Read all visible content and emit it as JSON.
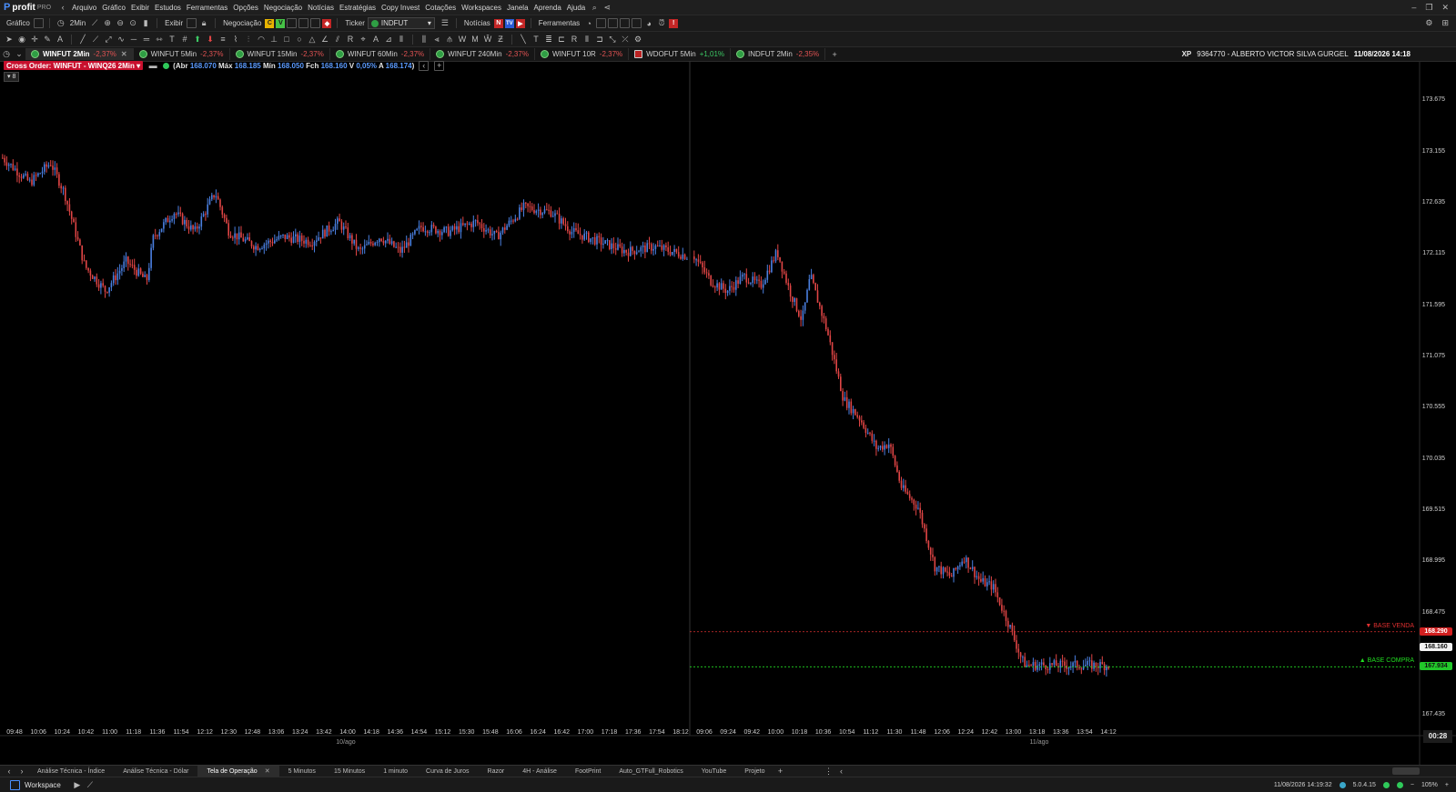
{
  "menubar": {
    "brand": "profit",
    "brand_suffix": "PRO",
    "items": [
      "Arquivo",
      "Gráfico",
      "Exibir",
      "Estudos",
      "Ferramentas",
      "Opções",
      "Negociação",
      "Notícias",
      "Estratégias",
      "Copy Invest",
      "Cotações",
      "Workspaces",
      "Janela",
      "Aprenda",
      "Ajuda"
    ]
  },
  "toolbar": {
    "grafico_label": "Gráfico",
    "timeframe": "2Min",
    "exibir_label": "Exibir",
    "negociacao_label": "Negociação",
    "ticker_label": "Ticker",
    "ticker_value": "INDFUT",
    "noticias_label": "Notícias",
    "ferramentas_label": "Ferramentas"
  },
  "chart_tabs": [
    {
      "label": "WINFUT 2Min",
      "change": "-2,37%",
      "active": true
    },
    {
      "label": "WINFUT 5Min",
      "change": "-2,37%",
      "active": false
    },
    {
      "label": "WINFUT 15Min",
      "change": "-2,37%",
      "active": false
    },
    {
      "label": "WINFUT 60Min",
      "change": "-2,37%",
      "active": false
    },
    {
      "label": "WINFUT 240Min",
      "change": "-2,37%",
      "active": false
    },
    {
      "label": "WINFUT 10R",
      "change": "-2,37%",
      "active": false
    },
    {
      "label": "WDOFUT 5Min",
      "change": "+1,01%",
      "active": false
    },
    {
      "label": "INDFUT 2Min",
      "change": "-2,35%",
      "active": false
    }
  ],
  "account": {
    "broker": "XP",
    "id": "9364770 - ALBERTO VICTOR SILVA GURGEL",
    "datetime": "11/08/2026 14:18"
  },
  "order": {
    "cross_label": "Cross Order: WINFUT - WINQ26 2Min",
    "abr_label": "Abr",
    "abr": "168.070",
    "max_label": "Máx",
    "max": "168.185",
    "min_label": "Mín",
    "min": "168.050",
    "fch_label": "Fch",
    "fch": "168.160",
    "v_label": "V",
    "v": "0,05%",
    "a_label": "A",
    "a": "168.174",
    "counter": "8"
  },
  "chart_data": {
    "type": "candlestick",
    "y_ticks": [
      "173.675",
      "173.155",
      "172.635",
      "172.115",
      "171.595",
      "171.075",
      "170.555",
      "170.035",
      "169.515",
      "168.995",
      "168.475",
      "167.435"
    ],
    "ylim": [
      167.3,
      173.9
    ],
    "x_ticks_day1": [
      "09:48",
      "10:06",
      "10:24",
      "10:42",
      "11:00",
      "11:18",
      "11:36",
      "11:54",
      "12:12",
      "12:30",
      "12:48",
      "13:06",
      "13:24",
      "13:42",
      "14:00",
      "14:18",
      "14:36",
      "14:54",
      "15:12",
      "15:30",
      "15:48",
      "16:06",
      "16:24",
      "16:42",
      "17:00",
      "17:18",
      "17:36",
      "17:54",
      "18:12"
    ],
    "x_ticks_day2": [
      "09:06",
      "09:24",
      "09:42",
      "10:00",
      "10:18",
      "10:36",
      "10:54",
      "11:12",
      "11:30",
      "11:48",
      "12:06",
      "12:24",
      "12:42",
      "13:00",
      "13:18",
      "13:36",
      "13:54",
      "14:12"
    ],
    "dates": [
      "10/ago",
      "11/ago"
    ],
    "path_day1": [
      [
        0,
        173.1
      ],
      [
        0.04,
        172.85
      ],
      [
        0.07,
        173.05
      ],
      [
        0.09,
        172.75
      ],
      [
        0.12,
        172.0
      ],
      [
        0.15,
        171.75
      ],
      [
        0.18,
        172.05
      ],
      [
        0.21,
        171.85
      ],
      [
        0.22,
        172.3
      ],
      [
        0.25,
        172.55
      ],
      [
        0.28,
        172.35
      ],
      [
        0.31,
        172.75
      ],
      [
        0.33,
        172.35
      ],
      [
        0.37,
        172.2
      ],
      [
        0.41,
        172.3
      ],
      [
        0.45,
        172.25
      ],
      [
        0.49,
        172.45
      ],
      [
        0.52,
        172.15
      ],
      [
        0.55,
        172.3
      ],
      [
        0.58,
        172.15
      ],
      [
        0.61,
        172.4
      ],
      [
        0.65,
        172.35
      ],
      [
        0.69,
        172.45
      ],
      [
        0.72,
        172.3
      ],
      [
        0.76,
        172.6
      ],
      [
        0.8,
        172.55
      ],
      [
        0.83,
        172.35
      ],
      [
        0.87,
        172.25
      ],
      [
        0.91,
        172.15
      ],
      [
        0.95,
        172.2
      ],
      [
        1.0,
        172.1
      ]
    ],
    "path_day2": [
      [
        0,
        172.1
      ],
      [
        0.04,
        171.85
      ],
      [
        0.08,
        171.75
      ],
      [
        0.12,
        171.9
      ],
      [
        0.16,
        171.8
      ],
      [
        0.2,
        172.15
      ],
      [
        0.23,
        171.75
      ],
      [
        0.26,
        171.45
      ],
      [
        0.28,
        171.9
      ],
      [
        0.32,
        171.35
      ],
      [
        0.36,
        170.65
      ],
      [
        0.4,
        170.45
      ],
      [
        0.44,
        170.15
      ],
      [
        0.47,
        170.2
      ],
      [
        0.5,
        169.75
      ],
      [
        0.54,
        169.55
      ],
      [
        0.58,
        168.95
      ],
      [
        0.62,
        168.85
      ],
      [
        0.65,
        169.05
      ],
      [
        0.69,
        168.8
      ],
      [
        0.72,
        168.75
      ],
      [
        0.76,
        168.35
      ],
      [
        0.79,
        168.0
      ],
      [
        0.8,
        167.95
      ]
    ],
    "base_venda": {
      "label": "▼ BASE VENDA",
      "price": "168.290",
      "color": "#e03030"
    },
    "base_compra": {
      "label": "▲ BASE COMPRA",
      "price": "167.934",
      "color": "#22dd22"
    },
    "last_price": "168.160",
    "bull_color": "#4a7fe0",
    "bear_color": "#e04545"
  },
  "clock": "00:28",
  "bottom_tabs": [
    {
      "label": "Análise Técnica - Índice",
      "active": false
    },
    {
      "label": "Análise Técnica - Dólar",
      "active": false
    },
    {
      "label": "Tela de Operação",
      "active": true
    },
    {
      "label": "5 Minutos",
      "active": false
    },
    {
      "label": "15 Minutos",
      "active": false
    },
    {
      "label": "1 minuto",
      "active": false
    },
    {
      "label": "Curva de Juros",
      "active": false
    },
    {
      "label": "Razor",
      "active": false
    },
    {
      "label": "4H - Análise",
      "active": false
    },
    {
      "label": "FootPrint",
      "active": false
    },
    {
      "label": "Auto_GTFull_Robotics",
      "active": false
    },
    {
      "label": "YouTube",
      "active": false
    },
    {
      "label": "Projeto",
      "active": false
    }
  ],
  "status": {
    "workspace_label": "Workspace",
    "datetime": "11/08/2026 14:19:32",
    "version": "5.0.4.15",
    "zoom": "105%"
  }
}
